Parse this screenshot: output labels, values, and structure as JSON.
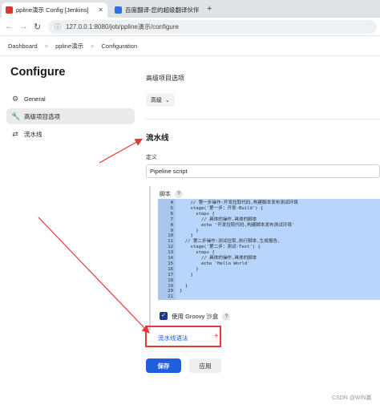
{
  "browser": {
    "tabs": [
      {
        "title": "ppline演示 Config [Jenkins]",
        "active": true,
        "favicon_color": "#d33833"
      },
      {
        "title": "百度翻译-您的超级翻译伙伴",
        "active": false,
        "favicon_color": "#2f6fe0"
      }
    ],
    "new_tab": "+",
    "close_glyph": "✕",
    "url": "127.0.0.1:8080/job/ppline演示/configure",
    "back": "←",
    "forward": "→",
    "reload": "↻"
  },
  "breadcrumb": {
    "items": [
      "Dashboard",
      "ppline演示",
      "Configuration"
    ],
    "separator": ">"
  },
  "sidebar": {
    "title": "Configure",
    "items": [
      {
        "label": "General",
        "icon": "gear-icon",
        "active": false
      },
      {
        "label": "高级项目选项",
        "icon": "wrench-icon",
        "active": true
      },
      {
        "label": "流水线",
        "icon": "pipeline-icon",
        "active": false
      }
    ]
  },
  "advanced": {
    "title": "高级项目选项",
    "button": "高级",
    "chevron": "⌄"
  },
  "pipeline": {
    "title": "流水线",
    "definition_label": "定义",
    "definition_value": "Pipeline script",
    "script_label": "脚本",
    "help": "?",
    "code_lines": [
      {
        "n": "4",
        "text": "    // 第一步操作:开发拉取代码,构建脚本发布测试环境"
      },
      {
        "n": "5",
        "text": "    stage('第一步：开发-Build') {"
      },
      {
        "n": "6",
        "text": "      steps {"
      },
      {
        "n": "7",
        "text": "        // 具体的操作,具体的脚本"
      },
      {
        "n": "8",
        "text": "        echo '开发拉取代码,构建脚本发布测试环境'"
      },
      {
        "n": "9",
        "text": "      }"
      },
      {
        "n": "10",
        "text": "    }"
      },
      {
        "n": "11",
        "text": "  // 第二步操作:测试拉取,执行脚本,生成报告,"
      },
      {
        "n": "12",
        "text": "    stage('第二步：测试-Test') {"
      },
      {
        "n": "13",
        "text": "      steps {"
      },
      {
        "n": "14",
        "text": "        // 具体的操作,具体的脚本"
      },
      {
        "n": "15",
        "text": "        echo 'Hello World'"
      },
      {
        "n": "16",
        "text": "      }"
      },
      {
        "n": "17",
        "text": "    }"
      },
      {
        "n": "18",
        "text": ""
      },
      {
        "n": "19",
        "text": "  }"
      },
      {
        "n": "20",
        "text": "}"
      },
      {
        "n": "21",
        "text": ""
      }
    ],
    "sandbox_label": "使用 Groovy 沙盒",
    "sandbox_checked": true,
    "syntax_link": "流水线语法",
    "plus": "+"
  },
  "actions": {
    "save": "保存",
    "apply": "应用"
  },
  "watermark": "CSDN @WIN赢",
  "colors": {
    "annotation_red": "#e53935",
    "primary_blue": "#1f5fdb",
    "code_selection": "#b8d6fb"
  }
}
